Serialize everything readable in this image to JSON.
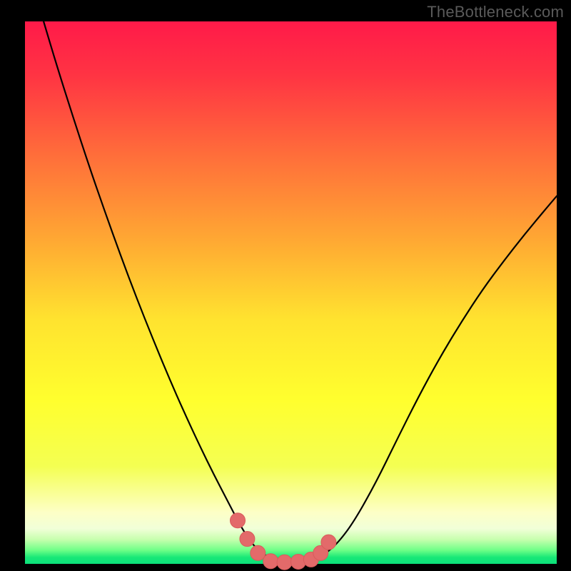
{
  "watermark": "TheBottleneck.com",
  "plot": {
    "inner_x": 35,
    "inner_y": 30,
    "inner_w": 745,
    "inner_h": 760,
    "gradient_stops": [
      {
        "offset": 0.0,
        "color": "#ff1a49"
      },
      {
        "offset": 0.1,
        "color": "#ff3443"
      },
      {
        "offset": 0.25,
        "color": "#ff6f3a"
      },
      {
        "offset": 0.4,
        "color": "#ffa733"
      },
      {
        "offset": 0.55,
        "color": "#ffe32f"
      },
      {
        "offset": 0.7,
        "color": "#ffff2e"
      },
      {
        "offset": 0.82,
        "color": "#f4ff52"
      },
      {
        "offset": 0.905,
        "color": "#fdffc6"
      },
      {
        "offset": 0.935,
        "color": "#f1ffd8"
      },
      {
        "offset": 0.955,
        "color": "#c7ffae"
      },
      {
        "offset": 0.975,
        "color": "#6dff87"
      },
      {
        "offset": 0.988,
        "color": "#19e877"
      },
      {
        "offset": 1.0,
        "color": "#0be07a"
      }
    ],
    "curve_stroke": "#000000",
    "curve_width": 2.2,
    "marker_fill": "#e36a6a",
    "marker_stroke": "#d95b5b",
    "marker_r": 10.5
  },
  "chart_data": {
    "type": "line",
    "title": "",
    "xlabel": "",
    "ylabel": "",
    "xlim": [
      0,
      1
    ],
    "ylim": [
      0,
      1
    ],
    "series": [
      {
        "name": "bottleneck-curve",
        "x": [
          0.035,
          0.06,
          0.09,
          0.12,
          0.15,
          0.18,
          0.21,
          0.24,
          0.27,
          0.3,
          0.33,
          0.355,
          0.38,
          0.402,
          0.418,
          0.43,
          0.445,
          0.462,
          0.48,
          0.5,
          0.52,
          0.54,
          0.562,
          0.59,
          0.62,
          0.66,
          0.7,
          0.74,
          0.78,
          0.82,
          0.86,
          0.9,
          0.94,
          0.98,
          1.0
        ],
        "y": [
          1.0,
          0.918,
          0.825,
          0.735,
          0.65,
          0.568,
          0.49,
          0.416,
          0.345,
          0.278,
          0.215,
          0.165,
          0.118,
          0.076,
          0.05,
          0.034,
          0.02,
          0.01,
          0.005,
          0.003,
          0.003,
          0.006,
          0.016,
          0.04,
          0.08,
          0.15,
          0.23,
          0.308,
          0.38,
          0.445,
          0.505,
          0.558,
          0.608,
          0.655,
          0.678
        ]
      }
    ],
    "markers": {
      "name": "highlight-dots",
      "x": [
        0.4,
        0.418,
        0.438,
        0.462,
        0.488,
        0.514,
        0.538,
        0.556,
        0.571
      ],
      "y": [
        0.08,
        0.046,
        0.02,
        0.005,
        0.003,
        0.004,
        0.008,
        0.02,
        0.04
      ]
    }
  }
}
